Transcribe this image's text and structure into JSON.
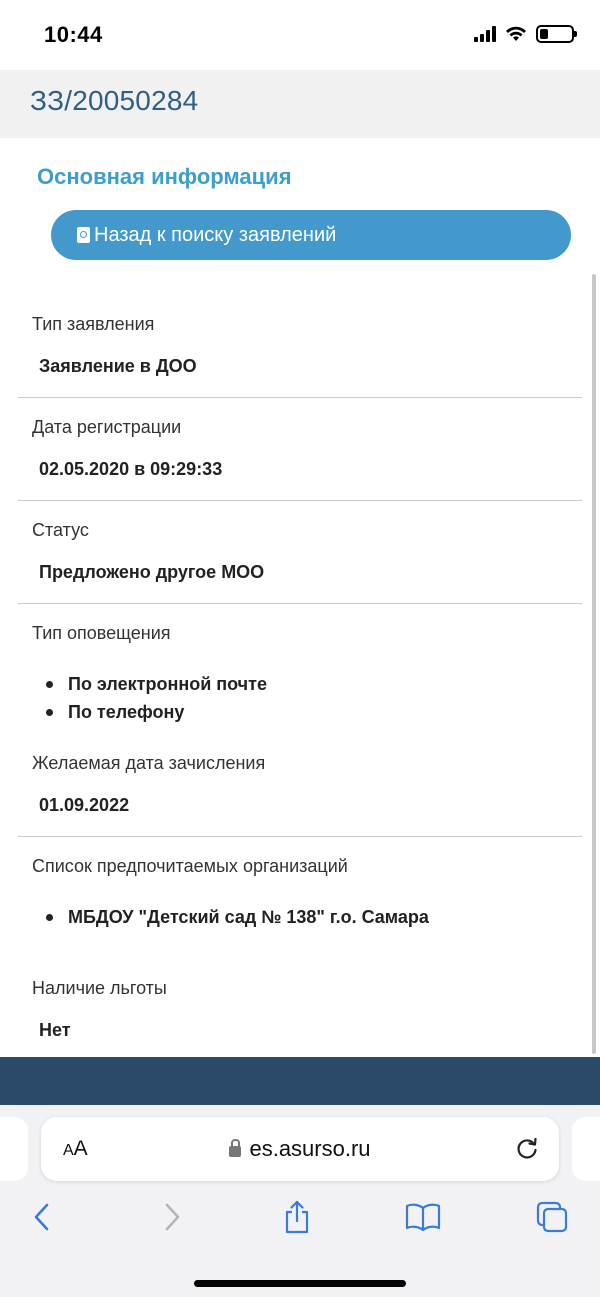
{
  "status_bar": {
    "time": "10:44"
  },
  "header": {
    "app_number": "ЗЗ/20050284"
  },
  "main": {
    "section_title": "Основная информация",
    "back_button": "Назад к поиску заявлений",
    "fields": {
      "type": {
        "label": "Тип заявления",
        "value": "Заявление в ДОО"
      },
      "reg_date": {
        "label": "Дата регистрации",
        "value": "02.05.2020 в 09:29:33"
      },
      "status": {
        "label": "Статус",
        "value": "Предложено другое МОО"
      },
      "notify": {
        "label": "Тип оповещения",
        "items": [
          "По электронной почте",
          "По телефону"
        ]
      },
      "desired_date": {
        "label": "Желаемая дата зачисления",
        "value": "01.09.2022"
      },
      "orgs": {
        "label": "Список предпочитаемых организаций",
        "items": [
          "МБДОУ \"Детский сад № 138\" г.о. Самара"
        ]
      },
      "benefit": {
        "label": "Наличие льготы",
        "value": "Нет"
      }
    }
  },
  "browser": {
    "aa_big": "A",
    "aa_small": "A",
    "url": "es.asurso.ru"
  },
  "colors": {
    "accent": "#4399cb",
    "header_text": "#2f5f86",
    "footer": "#2b4a69"
  }
}
